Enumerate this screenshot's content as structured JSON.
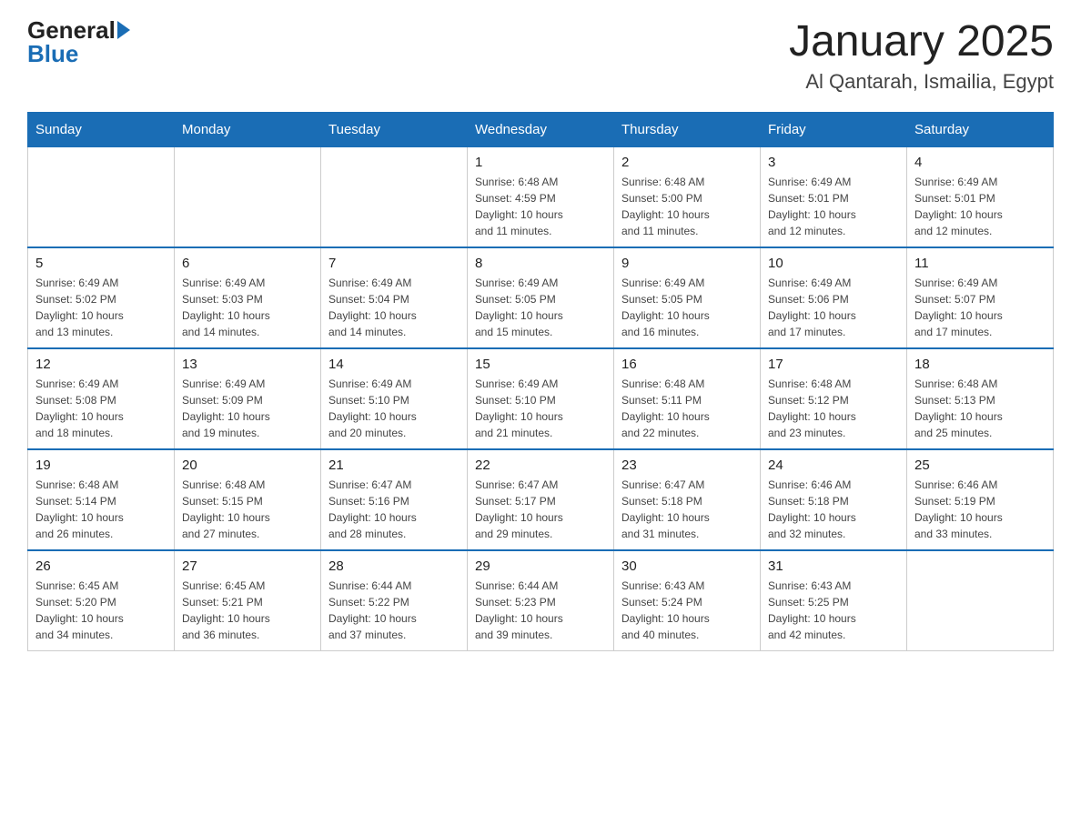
{
  "header": {
    "logo_general": "General",
    "logo_blue": "Blue",
    "month_title": "January 2025",
    "location": "Al Qantarah, Ismailia, Egypt"
  },
  "days_of_week": [
    "Sunday",
    "Monday",
    "Tuesday",
    "Wednesday",
    "Thursday",
    "Friday",
    "Saturday"
  ],
  "weeks": [
    [
      {
        "day": "",
        "info": ""
      },
      {
        "day": "",
        "info": ""
      },
      {
        "day": "",
        "info": ""
      },
      {
        "day": "1",
        "info": "Sunrise: 6:48 AM\nSunset: 4:59 PM\nDaylight: 10 hours\nand 11 minutes."
      },
      {
        "day": "2",
        "info": "Sunrise: 6:48 AM\nSunset: 5:00 PM\nDaylight: 10 hours\nand 11 minutes."
      },
      {
        "day": "3",
        "info": "Sunrise: 6:49 AM\nSunset: 5:01 PM\nDaylight: 10 hours\nand 12 minutes."
      },
      {
        "day": "4",
        "info": "Sunrise: 6:49 AM\nSunset: 5:01 PM\nDaylight: 10 hours\nand 12 minutes."
      }
    ],
    [
      {
        "day": "5",
        "info": "Sunrise: 6:49 AM\nSunset: 5:02 PM\nDaylight: 10 hours\nand 13 minutes."
      },
      {
        "day": "6",
        "info": "Sunrise: 6:49 AM\nSunset: 5:03 PM\nDaylight: 10 hours\nand 14 minutes."
      },
      {
        "day": "7",
        "info": "Sunrise: 6:49 AM\nSunset: 5:04 PM\nDaylight: 10 hours\nand 14 minutes."
      },
      {
        "day": "8",
        "info": "Sunrise: 6:49 AM\nSunset: 5:05 PM\nDaylight: 10 hours\nand 15 minutes."
      },
      {
        "day": "9",
        "info": "Sunrise: 6:49 AM\nSunset: 5:05 PM\nDaylight: 10 hours\nand 16 minutes."
      },
      {
        "day": "10",
        "info": "Sunrise: 6:49 AM\nSunset: 5:06 PM\nDaylight: 10 hours\nand 17 minutes."
      },
      {
        "day": "11",
        "info": "Sunrise: 6:49 AM\nSunset: 5:07 PM\nDaylight: 10 hours\nand 17 minutes."
      }
    ],
    [
      {
        "day": "12",
        "info": "Sunrise: 6:49 AM\nSunset: 5:08 PM\nDaylight: 10 hours\nand 18 minutes."
      },
      {
        "day": "13",
        "info": "Sunrise: 6:49 AM\nSunset: 5:09 PM\nDaylight: 10 hours\nand 19 minutes."
      },
      {
        "day": "14",
        "info": "Sunrise: 6:49 AM\nSunset: 5:10 PM\nDaylight: 10 hours\nand 20 minutes."
      },
      {
        "day": "15",
        "info": "Sunrise: 6:49 AM\nSunset: 5:10 PM\nDaylight: 10 hours\nand 21 minutes."
      },
      {
        "day": "16",
        "info": "Sunrise: 6:48 AM\nSunset: 5:11 PM\nDaylight: 10 hours\nand 22 minutes."
      },
      {
        "day": "17",
        "info": "Sunrise: 6:48 AM\nSunset: 5:12 PM\nDaylight: 10 hours\nand 23 minutes."
      },
      {
        "day": "18",
        "info": "Sunrise: 6:48 AM\nSunset: 5:13 PM\nDaylight: 10 hours\nand 25 minutes."
      }
    ],
    [
      {
        "day": "19",
        "info": "Sunrise: 6:48 AM\nSunset: 5:14 PM\nDaylight: 10 hours\nand 26 minutes."
      },
      {
        "day": "20",
        "info": "Sunrise: 6:48 AM\nSunset: 5:15 PM\nDaylight: 10 hours\nand 27 minutes."
      },
      {
        "day": "21",
        "info": "Sunrise: 6:47 AM\nSunset: 5:16 PM\nDaylight: 10 hours\nand 28 minutes."
      },
      {
        "day": "22",
        "info": "Sunrise: 6:47 AM\nSunset: 5:17 PM\nDaylight: 10 hours\nand 29 minutes."
      },
      {
        "day": "23",
        "info": "Sunrise: 6:47 AM\nSunset: 5:18 PM\nDaylight: 10 hours\nand 31 minutes."
      },
      {
        "day": "24",
        "info": "Sunrise: 6:46 AM\nSunset: 5:18 PM\nDaylight: 10 hours\nand 32 minutes."
      },
      {
        "day": "25",
        "info": "Sunrise: 6:46 AM\nSunset: 5:19 PM\nDaylight: 10 hours\nand 33 minutes."
      }
    ],
    [
      {
        "day": "26",
        "info": "Sunrise: 6:45 AM\nSunset: 5:20 PM\nDaylight: 10 hours\nand 34 minutes."
      },
      {
        "day": "27",
        "info": "Sunrise: 6:45 AM\nSunset: 5:21 PM\nDaylight: 10 hours\nand 36 minutes."
      },
      {
        "day": "28",
        "info": "Sunrise: 6:44 AM\nSunset: 5:22 PM\nDaylight: 10 hours\nand 37 minutes."
      },
      {
        "day": "29",
        "info": "Sunrise: 6:44 AM\nSunset: 5:23 PM\nDaylight: 10 hours\nand 39 minutes."
      },
      {
        "day": "30",
        "info": "Sunrise: 6:43 AM\nSunset: 5:24 PM\nDaylight: 10 hours\nand 40 minutes."
      },
      {
        "day": "31",
        "info": "Sunrise: 6:43 AM\nSunset: 5:25 PM\nDaylight: 10 hours\nand 42 minutes."
      },
      {
        "day": "",
        "info": ""
      }
    ]
  ]
}
